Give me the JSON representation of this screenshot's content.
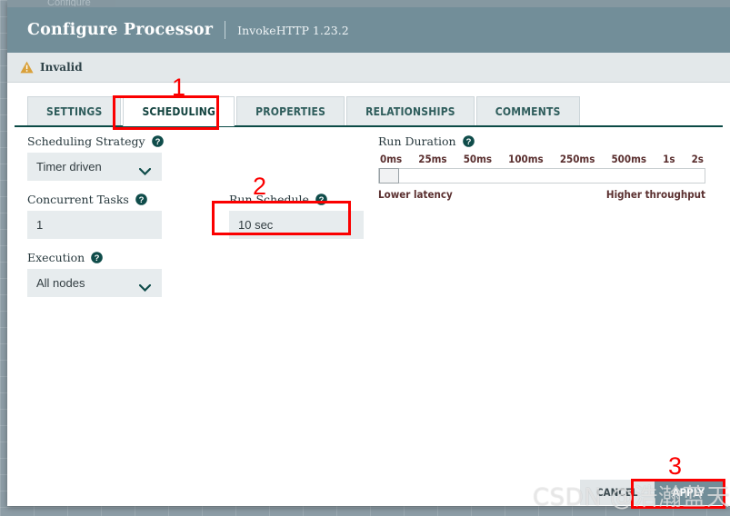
{
  "window": {
    "title": "Configure Processor",
    "subtitle": "InvokeHTTP 1.23.2",
    "ghost_strip": "Configure"
  },
  "status": {
    "icon": "warning-triangle-icon",
    "label": "Invalid"
  },
  "tabs": [
    {
      "label": "SETTINGS",
      "active": false
    },
    {
      "label": "SCHEDULING",
      "active": true
    },
    {
      "label": "PROPERTIES",
      "active": false
    },
    {
      "label": "RELATIONSHIPS",
      "active": false
    },
    {
      "label": "COMMENTS",
      "active": false
    }
  ],
  "form": {
    "scheduling_strategy": {
      "label": "Scheduling Strategy",
      "value": "Timer driven",
      "help_icon": "help-circle-icon",
      "caret_icon": "chevron-down-icon"
    },
    "concurrent_tasks": {
      "label": "Concurrent Tasks",
      "value": "1",
      "help_icon": "help-circle-icon"
    },
    "execution": {
      "label": "Execution",
      "value": "All nodes",
      "help_icon": "help-circle-icon",
      "caret_icon": "chevron-down-icon"
    },
    "run_schedule": {
      "label": "Run Schedule",
      "value": "10 sec",
      "help_icon": "help-circle-icon"
    },
    "run_duration": {
      "label": "Run Duration",
      "help_icon": "help-circle-icon",
      "ticks": [
        "0ms",
        "25ms",
        "50ms",
        "100ms",
        "250ms",
        "500ms",
        "1s",
        "2s"
      ],
      "left_caption": "Lower latency",
      "right_caption": "Higher throughput",
      "handle_position_percent": 0
    }
  },
  "footer": {
    "cancel_label": "CANCEL",
    "apply_label": "APPLY"
  },
  "watermark": {
    "text": "CSDN @浩瀚蓝天dep"
  },
  "annotations": {
    "marker_1": "1",
    "marker_2": "2",
    "marker_3": "3"
  },
  "colors": {
    "header_bg": "#728e99",
    "tab_active_underline": "#0b4a46",
    "field_bg": "#e7ecee",
    "annotation_red": "#fb0000",
    "warning_amber": "#d9a13b",
    "apply_button_bg": "#728e99"
  }
}
